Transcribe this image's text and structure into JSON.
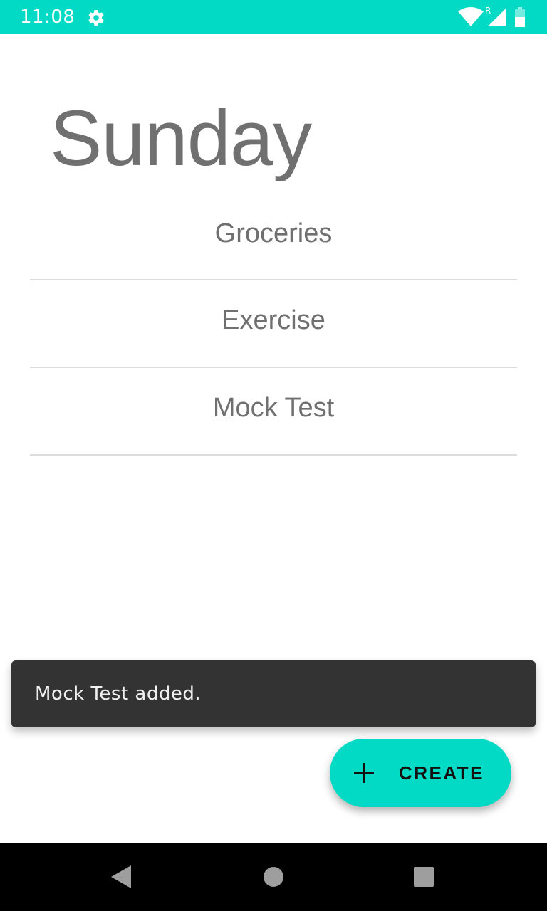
{
  "status_bar": {
    "time": "11:08",
    "roaming_indicator": "R",
    "icons": [
      "gear-icon",
      "wifi-icon",
      "signal-icon",
      "battery-icon"
    ],
    "background_color": "#03dac5"
  },
  "main": {
    "day_title": "Sunday",
    "tasks": [
      {
        "label": "Groceries"
      },
      {
        "label": "Exercise"
      },
      {
        "label": "Mock Test"
      }
    ]
  },
  "snackbar": {
    "message": "Mock Test added."
  },
  "fab": {
    "label": "CREATE",
    "icon": "plus-icon",
    "color": "#03dac5"
  },
  "nav_bar": {
    "icons": [
      "back-icon",
      "home-icon",
      "recents-icon"
    ]
  }
}
